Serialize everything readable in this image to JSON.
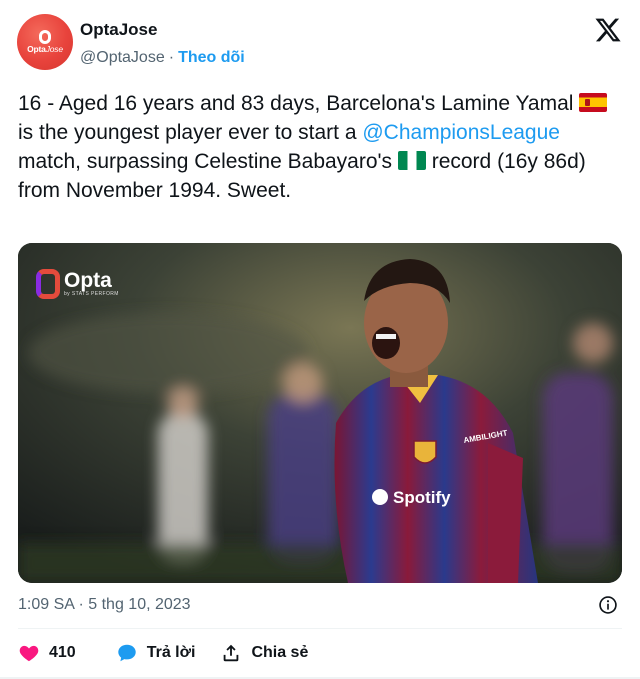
{
  "author": {
    "name": "OptaJose",
    "handle": "@OptaJose",
    "separator": "·",
    "follow_label": "Theo dõi",
    "avatar_text_a": "Opta",
    "avatar_text_b": "Jose",
    "avatar_color": "#e8433c"
  },
  "platform_icon": "x-logo-icon",
  "tweet": {
    "part1": "16 - Aged 16 years and 83 days, Barcelona's Lamine Yamal ",
    "flag1": "spain-flag-icon",
    "part2": " is the youngest player ever to start a ",
    "mention": "@ChampionsLeague",
    "part3": " match, surpassing Celestine Babayaro's ",
    "flag2": "nigeria-flag-icon",
    "part4": " record (16y 86d) from November 1994. Sweet."
  },
  "media": {
    "watermark_brand": "Opta",
    "watermark_sub": "by STATS PERFORM",
    "jersey_sponsor": "Spotify",
    "jersey_sleeve": "AMBILIGHT"
  },
  "meta": {
    "timestamp": "1:09 SA · 5 thg 10, 2023"
  },
  "actions": {
    "like_count": "410",
    "reply_label": "Trả lời",
    "share_label": "Chia sẻ"
  },
  "colors": {
    "link": "#1d9bf0",
    "like": "#f91880",
    "text": "#0f1419",
    "muted": "#536471"
  }
}
